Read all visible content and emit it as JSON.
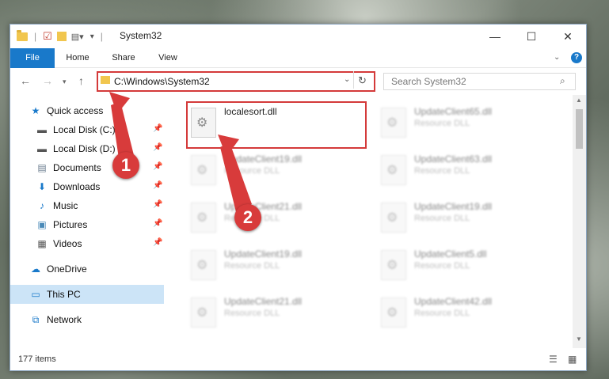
{
  "window": {
    "title": "System32",
    "controls": {
      "minimize": "—",
      "maximize": "☐",
      "close": "✕"
    }
  },
  "ribbon": {
    "tabs": [
      "File",
      "Home",
      "Share",
      "View"
    ],
    "help_icon": "?"
  },
  "navigation": {
    "address": "C:\\Windows\\System32",
    "search_placeholder": "Search System32"
  },
  "sidebar": {
    "items": [
      {
        "label": "Quick access",
        "icon": "star-icon"
      },
      {
        "label": "Local Disk (C:)",
        "icon": "drive-icon"
      },
      {
        "label": "Local Disk (D:)",
        "icon": "drive-icon"
      },
      {
        "label": "Documents",
        "icon": "document-icon"
      },
      {
        "label": "Downloads",
        "icon": "download-icon"
      },
      {
        "label": "Music",
        "icon": "music-icon"
      },
      {
        "label": "Pictures",
        "icon": "pictures-icon"
      },
      {
        "label": "Videos",
        "icon": "videos-icon"
      },
      {
        "label": "OneDrive",
        "icon": "cloud-icon"
      },
      {
        "label": "This PC",
        "icon": "computer-icon"
      },
      {
        "label": "Network",
        "icon": "network-icon"
      }
    ]
  },
  "files": [
    {
      "name": "localesort.dll",
      "type": ""
    },
    {
      "name": "UpdateClient65.dll",
      "type": "Resource DLL"
    },
    {
      "name": "UpdateClient19.dll",
      "type": "Resource DLL"
    },
    {
      "name": "UpdateClient63.dll",
      "type": "Resource DLL"
    },
    {
      "name": "UpdateClient21.dll",
      "type": "Resource DLL"
    },
    {
      "name": "UpdateClient19.dll",
      "type": "Resource DLL"
    },
    {
      "name": "UpdateClient19.dll",
      "type": "Resource DLL"
    },
    {
      "name": "UpdateClient5.dll",
      "type": "Resource DLL"
    },
    {
      "name": "UpdateClient21.dll",
      "type": "Resource DLL"
    },
    {
      "name": "UpdateClient42.dll",
      "type": "Resource DLL"
    }
  ],
  "status": {
    "items_count": "177 items"
  },
  "callouts": [
    "1",
    "2"
  ],
  "colors": {
    "accent": "#1979ca",
    "highlight": "#d43a3a"
  }
}
